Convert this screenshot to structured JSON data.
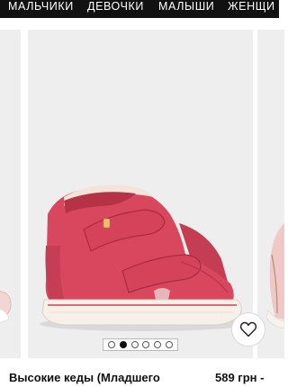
{
  "nav": {
    "items": [
      "МАЛЬЧИКИ",
      "ДЕВОЧКИ",
      "МАЛЫШИ",
      "ЖЕНЩИ"
    ]
  },
  "carousel": {
    "dot_count": 6,
    "active_dot": 1,
    "favorite_icon": "heart-outline-icon"
  },
  "product": {
    "title": "Высокие кеды (Младшего",
    "price": "589 грн -"
  },
  "colors": {
    "nav_bg": "#111111",
    "shoe_pink": "#d9475f",
    "panel_bg": "#eeeeee"
  }
}
